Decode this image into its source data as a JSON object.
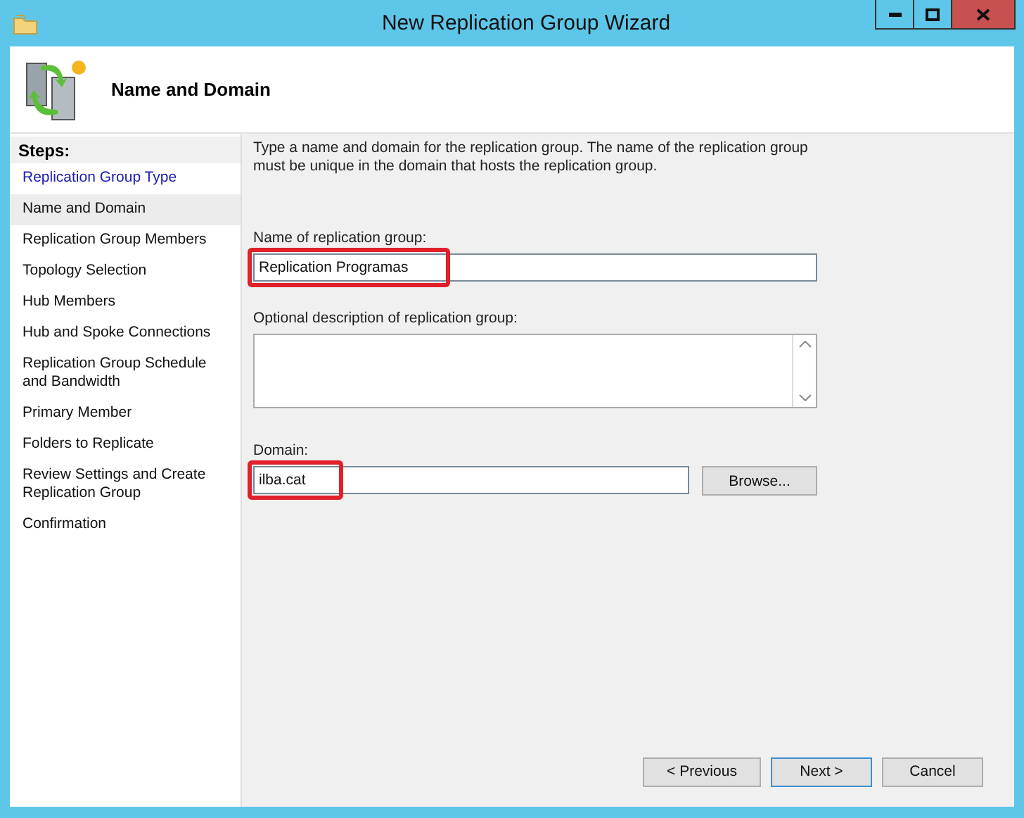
{
  "window": {
    "title": "New Replication Group Wizard"
  },
  "header": {
    "title": "Name and Domain"
  },
  "steps": {
    "heading": "Steps:",
    "items": [
      {
        "label": "Replication Group Type",
        "selected": false,
        "completed": true
      },
      {
        "label": "Name and Domain",
        "selected": true,
        "completed": false
      },
      {
        "label": "Replication Group Members",
        "selected": false,
        "completed": false
      },
      {
        "label": "Topology Selection",
        "selected": false,
        "completed": false
      },
      {
        "label": "Hub Members",
        "selected": false,
        "completed": false
      },
      {
        "label": "Hub and Spoke Connections",
        "selected": false,
        "completed": false
      },
      {
        "label": "Replication Group Schedule and Bandwidth",
        "selected": false,
        "completed": false
      },
      {
        "label": "Primary Member",
        "selected": false,
        "completed": false
      },
      {
        "label": "Folders to Replicate",
        "selected": false,
        "completed": false
      },
      {
        "label": "Review Settings and Create Replication Group",
        "selected": false,
        "completed": false
      },
      {
        "label": "Confirmation",
        "selected": false,
        "completed": false
      }
    ]
  },
  "instructions": "Type a name and domain for the replication group. The name of the replication group must be unique in the domain that hosts the replication group.",
  "name_field": {
    "label": "Name of replication group:",
    "value": "Replication Programas",
    "highlighted": true
  },
  "description_field": {
    "label": "Optional description of replication group:"
  },
  "domain_field": {
    "label": "Domain:",
    "value": "ilba.cat",
    "highlighted": true,
    "button": "Browse..."
  },
  "buttons": [
    {
      "label": "< Previous",
      "default": false
    },
    {
      "label": "Next >",
      "default": true
    },
    {
      "label": "Cancel",
      "default": false
    }
  ]
}
